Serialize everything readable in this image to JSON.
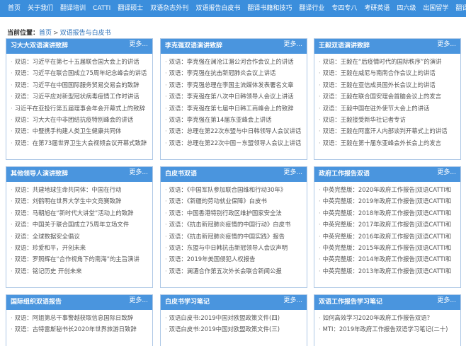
{
  "nav": [
    "首页",
    "关于我们",
    "翻译培训",
    "CATTI",
    "翻译硕士",
    "双语杂志外刊",
    "双语报告白皮书",
    "翻译书籍和技巧",
    "翻译行业",
    "专四专八",
    "考研英语",
    "四六级",
    "出国留学",
    "翻译"
  ],
  "breadcrumb": {
    "label": "当前位置：",
    "home": "首页",
    "separator": ">",
    "current": "双语报告与白皮书"
  },
  "more_label": "更多...",
  "panels": [
    {
      "title": "习大大双语演讲致辞",
      "items": [
        "双语：习近平在第七十五届联合国大会上的讲话",
        "双语：习近平在联合国成立75周年纪念峰会的讲话",
        "双语：习近平在中国国际服务贸易交易会的致辞",
        "双语：习近平应对新型冠状病毒疫情工作时讲话",
        "习近平在亚投行第五届理事会年会开幕式上的致辞",
        "双语：习大大在中非团结抗疫特别峰会的讲话",
        "双语：中暨携手构建人类卫生健康共同体",
        "双语：在第73届世界卫生大会视频会议开幕式致辞"
      ]
    },
    {
      "title": "李克强双语演讲致辞",
      "items": [
        "双语：李克强在澜沧江湄公河合作会议上的讲话",
        "双语：李克强在抗击新冠肺炎会议上讲话",
        "双语：李克强总理在李国主流媒体发表署名文章",
        "双语：李克强在第八次中日韩领导人会议上讲话",
        "双语：李克强在第七届中日韩工商峰会上的致辞",
        "双语：李克强在第14届东亚峰会上讲话",
        "双语：总理在第22次东盟与中日韩领导人会议讲话",
        "双语：总理在第22次中国－东盟领导人会议上讲话"
      ]
    },
    {
      "title": "王毅双语演讲致辞",
      "items": [
        "双语：王毅在“后疫情时代的国际秩序”的演讲",
        "双语：王毅在威尼与南南合作会议上的讲话",
        "双语：王毅在亚信成员国外长会议上的讲话",
        "双语：王毅在联合国安理会首脑会议上的发言",
        "双语：王毅中国在驻外使节大会上的讲话",
        "双语：王毅接受新华社记者专访",
        "双语：王毅在阿富汗人内部谈判开幕式上的讲话",
        "双语：王毅在第十届东亚峰会外长会上的发言"
      ]
    },
    {
      "title": "其他领导人演讲致辞",
      "items": [
        "双语：共建地球生命共同体：中国在行动",
        "双语：刘鹤明在世界大学生中文竞赛致辞",
        "双语：马朝旭在“新时代大讲堂”活动上的致辞",
        "双语：中国关于联合国成立75周年立场文件",
        "双语：全球数据安全倡议",
        "双语：珍爱和平，开创未来",
        "双语：罗照辉在“合作视角下的南海”的主旨演讲",
        "双语：铭记历史 开创未来"
      ]
    },
    {
      "title": "白皮书双语",
      "items": [
        "双语：《中国军队参加联合国维和行动30年》",
        "双语：《新疆的劳动就业保障》白皮书",
        "双语：中国香港特别行政区维护国家安全法",
        "双语：《抗击新冠肺炎疫情的中国行动》白皮书",
        "双语：《抗击新冠肺炎疫情的中国实践》报告",
        "双语：东盟与中日韩抗击新冠领导人会议声明",
        "双语：2019年美国侵犯人权报告",
        "双语：澜湄合作第五次外长会联合新闻公报"
      ]
    },
    {
      "title": "政府工作报告双语",
      "items": [
        "中英完整版：2020年政府工作报告|双语CATTI和",
        "中英完整版：2019年政府工作报告|双语CATTI和",
        "中英完整版：2018年政府工作报告|双语CATTI和",
        "中英完整版：2017年政府工作报告|双语CATTI和",
        "中英完整版：2016年政府工作报告|双语CATTI和",
        "中英完整版：2015年政府工作报告|双语CATTI和",
        "中英完整版：2014年政府工作报告|双语CATTI和",
        "中英完整版：2013年政府工作报告|双语CATTI和"
      ]
    },
    {
      "title": "国际组织双语报告",
      "items": [
        "双语：阿姐第总干事警越获取信息国际日致辞",
        "双语：古特雷斯秘书长2020年世界旅游日致辞"
      ]
    },
    {
      "title": "白皮书学习笔记",
      "items": [
        "双语白皮书:2019中国对欧盟政策文件(四)",
        "双语白皮书:2019中国对欧盟政策文件(三)"
      ]
    },
    {
      "title": "双语工作报告学习笔记",
      "items": [
        "如何高效学习2020年政府工作报告双语？",
        "MTI：2019年政府工作报告双语学习笔记(二十)"
      ]
    }
  ]
}
